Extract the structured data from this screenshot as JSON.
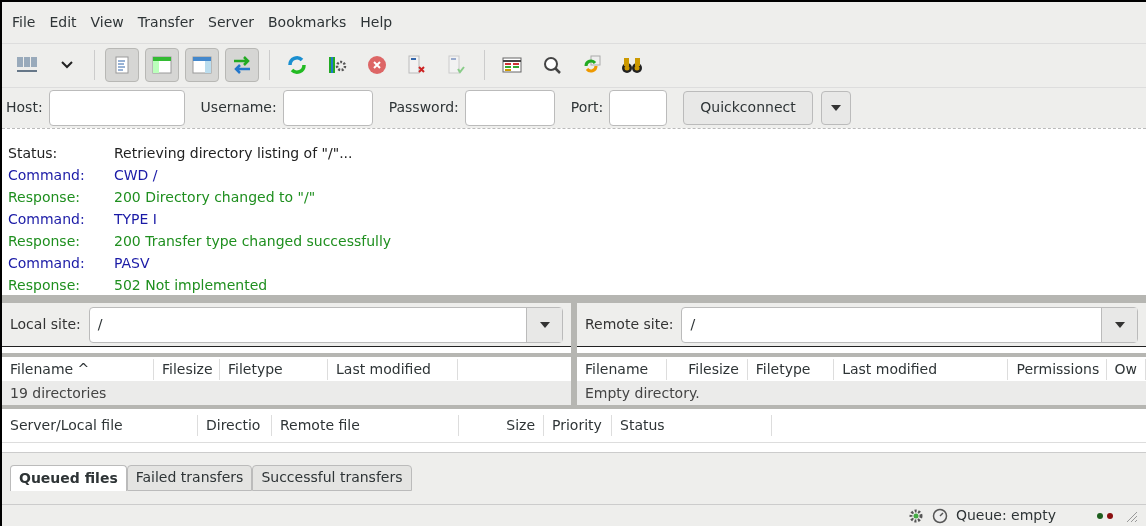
{
  "menu": [
    "File",
    "Edit",
    "View",
    "Transfer",
    "Server",
    "Bookmarks",
    "Help"
  ],
  "toolbar": [
    {
      "kind": "site-manager",
      "pressed": false
    },
    {
      "kind": "dropdown",
      "pressed": false
    },
    {
      "kind": "sep"
    },
    {
      "kind": "log",
      "pressed": true
    },
    {
      "kind": "local-tree",
      "pressed": true
    },
    {
      "kind": "remote-tree",
      "pressed": true
    },
    {
      "kind": "queue",
      "pressed": true
    },
    {
      "kind": "sep"
    },
    {
      "kind": "refresh",
      "pressed": false
    },
    {
      "kind": "filter",
      "pressed": false
    },
    {
      "kind": "cancel",
      "pressed": false
    },
    {
      "kind": "disconnect",
      "pressed": false
    },
    {
      "kind": "reconnect",
      "pressed": false
    },
    {
      "kind": "sep"
    },
    {
      "kind": "compare",
      "pressed": false
    },
    {
      "kind": "search",
      "pressed": false
    },
    {
      "kind": "sync",
      "pressed": false
    },
    {
      "kind": "find",
      "pressed": false
    }
  ],
  "quickconnect": {
    "fields": [
      {
        "label": "Host:"
      },
      {
        "label": "Username:"
      },
      {
        "label": "Password:"
      },
      {
        "label": "Port:"
      }
    ],
    "button": "Quickconnect"
  },
  "log": [
    {
      "kind": "status",
      "label": "Status:",
      "text": "Retrieving directory listing of \"/\"..."
    },
    {
      "kind": "command",
      "label": "Command:",
      "text": "CWD /"
    },
    {
      "kind": "response",
      "label": "Response:",
      "text": "200 Directory changed to \"/\""
    },
    {
      "kind": "command",
      "label": "Command:",
      "text": "TYPE I"
    },
    {
      "kind": "response",
      "label": "Response:",
      "text": "200 Transfer type changed successfully"
    },
    {
      "kind": "command",
      "label": "Command:",
      "text": "PASV"
    },
    {
      "kind": "response",
      "label": "Response:",
      "text": "502 Not implemented"
    }
  ],
  "local": {
    "label": "Local site:",
    "path": "/",
    "columns": [
      "Filename ^",
      "Filesize",
      "Filetype",
      "Last modified"
    ],
    "summary": "19 directories"
  },
  "remote": {
    "label": "Remote site:",
    "path": "/",
    "columns": [
      "Filename",
      "Filesize",
      "Filetype",
      "Last modified",
      "Permissions",
      "Ow"
    ],
    "summary": "Empty directory."
  },
  "queue": {
    "columns": [
      "Server/Local file",
      "Directio",
      "Remote file",
      "Size",
      "Priority",
      "Status"
    ]
  },
  "tabs": [
    {
      "label": "Queued files",
      "selected": true
    },
    {
      "label": "Failed transfers",
      "selected": false
    },
    {
      "label": "Successful transfers",
      "selected": false
    }
  ],
  "status_bar": {
    "queue": "Queue: empty"
  }
}
